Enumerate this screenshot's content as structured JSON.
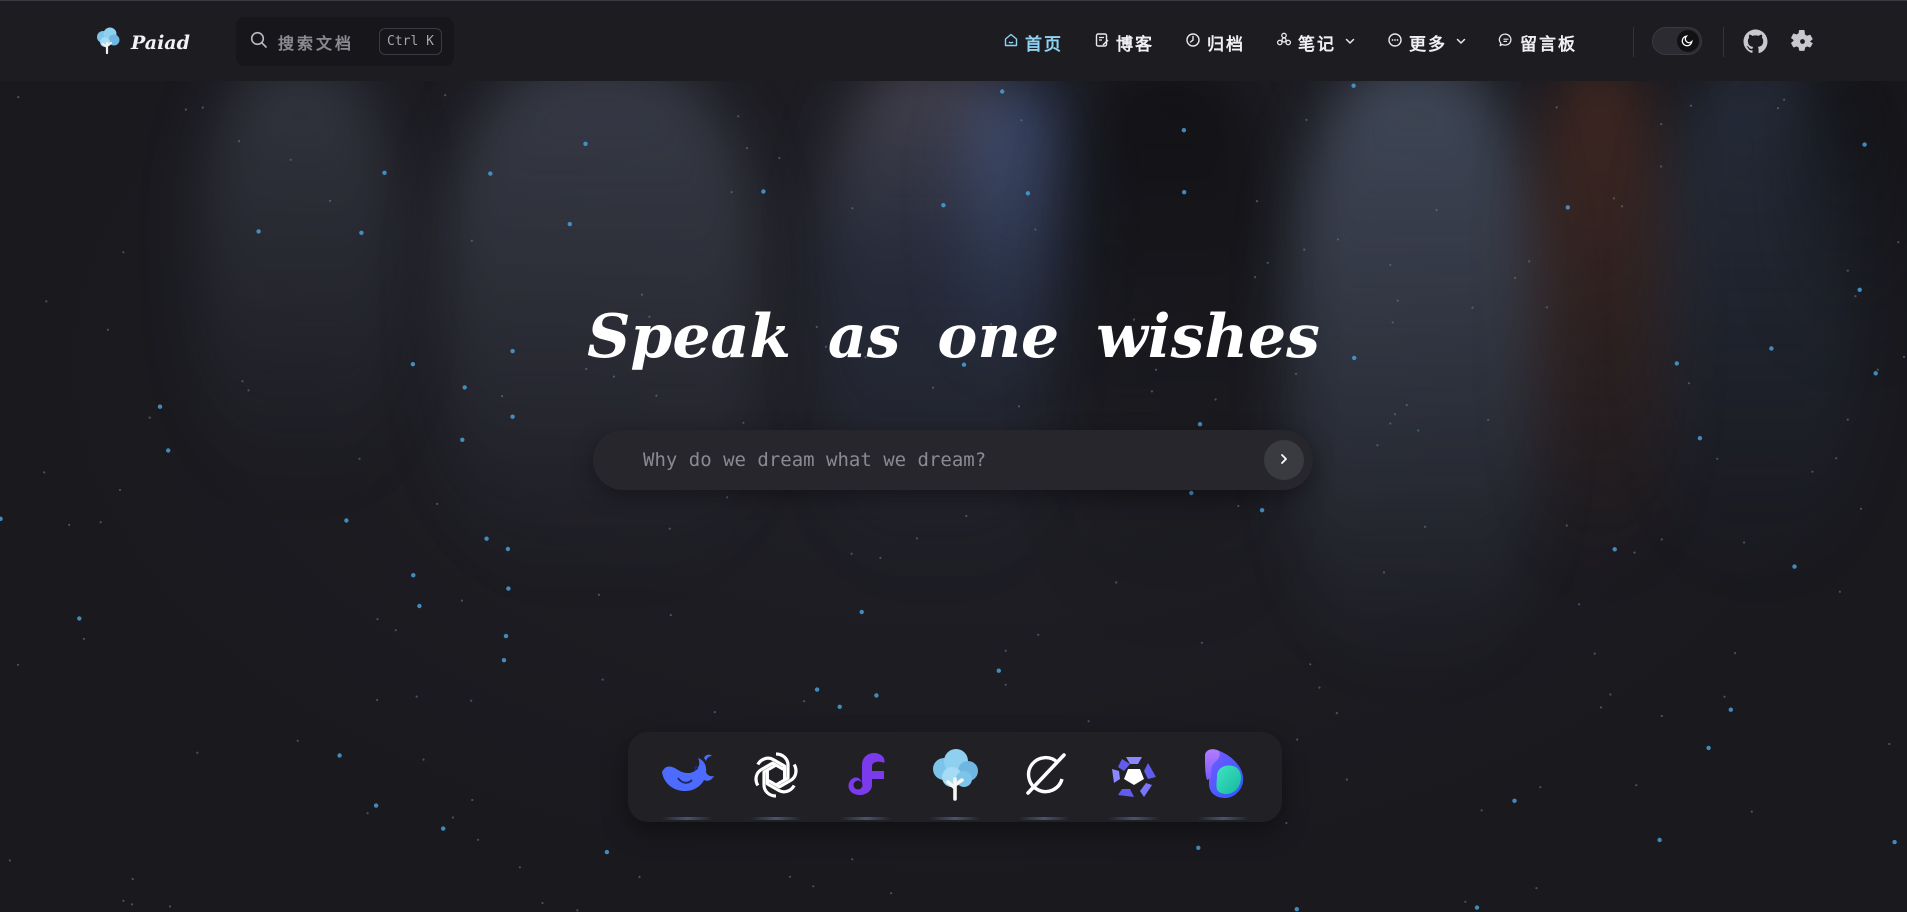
{
  "brand": {
    "name": "Paiad",
    "logo_icon": "cloud-tree-icon"
  },
  "search": {
    "label": "搜索文档",
    "shortcut": "Ctrl K",
    "icon": "search-icon"
  },
  "nav": {
    "items": [
      {
        "label": "首页",
        "icon": "home-icon",
        "active": true
      },
      {
        "label": "博客",
        "icon": "blog-icon"
      },
      {
        "label": "归档",
        "icon": "archive-clock-icon"
      },
      {
        "label": "笔记",
        "icon": "notes-icon",
        "dropdown": true
      },
      {
        "label": "更多",
        "icon": "more-circle-icon",
        "dropdown": true
      },
      {
        "label": "留言板",
        "icon": "message-icon"
      }
    ],
    "theme_toggle_icon": "moon-icon",
    "github_icon": "github-icon",
    "settings_icon": "gear-icon"
  },
  "hero": {
    "title": "Speak as one wishes",
    "ask_placeholder": "Why do we dream what we dream?",
    "submit_icon": "chevron-right-icon"
  },
  "dock": {
    "items": [
      {
        "icon": "deepseek-whale-icon",
        "color": "#4d6bfe"
      },
      {
        "icon": "openai-icon",
        "color": "#ffffff"
      },
      {
        "icon": "flux-f-icon",
        "color": "#7c3aed"
      },
      {
        "icon": "cloud-tree-icon",
        "color": "#6fbde8"
      },
      {
        "icon": "grok-icon",
        "color": "#ffffff"
      },
      {
        "icon": "qwen-icon",
        "color": "#615ced"
      },
      {
        "icon": "copilot-icon",
        "color": "#3dd6b0"
      }
    ]
  },
  "colors": {
    "background": "#1b1b20",
    "nav_background": "#1c1c21",
    "accent": "#8ed3f2",
    "star": "#4a9fd8"
  }
}
